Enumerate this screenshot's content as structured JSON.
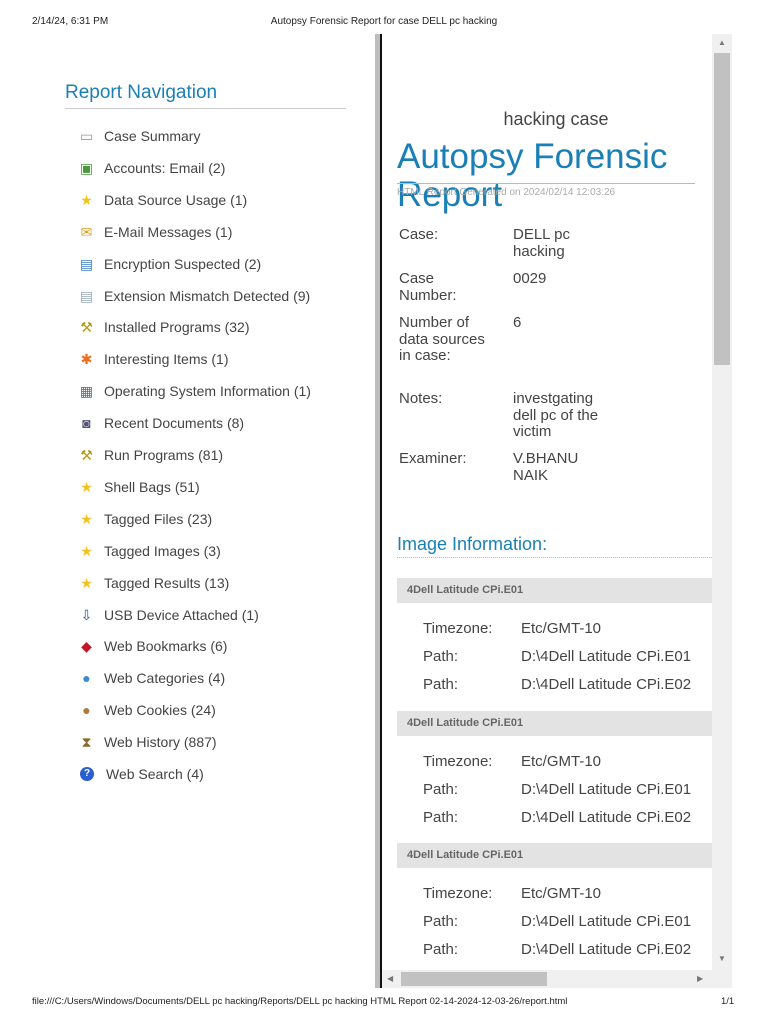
{
  "print": {
    "datetime": "2/14/24, 6:31 PM",
    "doc_title": "Autopsy Forensic Report for case DELL pc hacking",
    "url": "file:///C:/Users/Windows/Documents/DELL pc hacking/Reports/DELL pc hacking HTML Report 02-14-2024-12-03-26/report.html",
    "page": "1/1"
  },
  "nav": {
    "title": "Report Navigation",
    "items": [
      {
        "label": "Case Summary",
        "icon": "briefcase-icon"
      },
      {
        "label": "Accounts: Email (2)",
        "icon": "accounts-icon"
      },
      {
        "label": "Data Source Usage (1)",
        "icon": "star-icon"
      },
      {
        "label": "E-Mail Messages (1)",
        "icon": "envelope-icon"
      },
      {
        "label": "Encryption Suspected (2)",
        "icon": "encrypted-doc-icon"
      },
      {
        "label": "Extension Mismatch Detected (9)",
        "icon": "file-mismatch-icon"
      },
      {
        "label": "Installed Programs (32)",
        "icon": "programs-icon"
      },
      {
        "label": "Interesting Items (1)",
        "icon": "asterisk-icon"
      },
      {
        "label": "Operating System Information (1)",
        "icon": "computer-icon"
      },
      {
        "label": "Recent Documents (8)",
        "icon": "recent-doc-icon"
      },
      {
        "label": "Run Programs (81)",
        "icon": "programs-icon"
      },
      {
        "label": "Shell Bags (51)",
        "icon": "star-icon"
      },
      {
        "label": "Tagged Files (23)",
        "icon": "star-icon"
      },
      {
        "label": "Tagged Images (3)",
        "icon": "star-icon"
      },
      {
        "label": "Tagged Results (13)",
        "icon": "star-icon"
      },
      {
        "label": "USB Device Attached (1)",
        "icon": "usb-icon"
      },
      {
        "label": "Web Bookmarks (6)",
        "icon": "bookmark-icon"
      },
      {
        "label": "Web Categories (4)",
        "icon": "globe-icon"
      },
      {
        "label": "Web Cookies (24)",
        "icon": "cookie-icon"
      },
      {
        "label": "Web History (887)",
        "icon": "hourglass-icon"
      },
      {
        "label": "Web Search (4)",
        "icon": "help-search-icon"
      }
    ]
  },
  "report": {
    "case_heading": "hacking case",
    "title": "Autopsy Forensic Report",
    "generated": "HTML Report Generated on 2024/02/14 12:03:26",
    "info": [
      {
        "label": "Case:",
        "value": "DELL pc hacking"
      },
      {
        "label": "Case Number:",
        "value": "0029"
      },
      {
        "label": "Number of data sources in case:",
        "value": "6"
      },
      {
        "label": "Notes:",
        "value": "investgating dell pc of the victim"
      },
      {
        "label": "Examiner:",
        "value": "V.BHANU NAIK"
      }
    ],
    "image_heading": "Image Information:",
    "images": [
      {
        "name": "4Dell Latitude CPi.E01",
        "tz_label": "Timezone:",
        "tz": "Etc/GMT-10",
        "path_label": "Path:",
        "paths": [
          "D:\\4Dell Latitude CPi.E01",
          "D:\\4Dell Latitude CPi.E02"
        ]
      },
      {
        "name": "4Dell Latitude CPi.E01",
        "tz_label": "Timezone:",
        "tz": "Etc/GMT-10",
        "path_label": "Path:",
        "paths": [
          "D:\\4Dell Latitude CPi.E01",
          "D:\\4Dell Latitude CPi.E02"
        ]
      },
      {
        "name": "4Dell Latitude CPi.E01",
        "tz_label": "Timezone:",
        "tz": "Etc/GMT-10",
        "path_label": "Path:",
        "paths": [
          "D:\\4Dell Latitude CPi.E01",
          "D:\\4Dell Latitude CPi.E02"
        ]
      }
    ]
  }
}
